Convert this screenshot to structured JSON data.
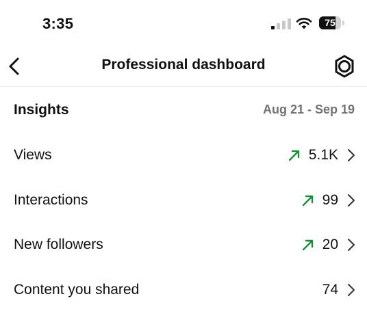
{
  "status_bar": {
    "time": "3:35",
    "battery_level": "75",
    "battery_fraction": 0.75,
    "icons": [
      "signal-icon",
      "wifi-icon",
      "battery-icon"
    ]
  },
  "header": {
    "title": "Professional dashboard",
    "back_icon": "chevron-left-icon",
    "settings_icon": "settings-gear-icon"
  },
  "insights": {
    "title": "Insights",
    "date_range": "Aug 21 - Sep 19",
    "metrics": [
      {
        "label": "Views",
        "value": "5.1K",
        "trend": "up"
      },
      {
        "label": "Interactions",
        "value": "99",
        "trend": "up"
      },
      {
        "label": "New followers",
        "value": "20",
        "trend": "up"
      },
      {
        "label": "Content you shared",
        "value": "74",
        "trend": "none"
      }
    ]
  },
  "colors": {
    "trend_up": "#1e8a3c",
    "secondary_text": "#737373",
    "primary_text": "#111111"
  }
}
